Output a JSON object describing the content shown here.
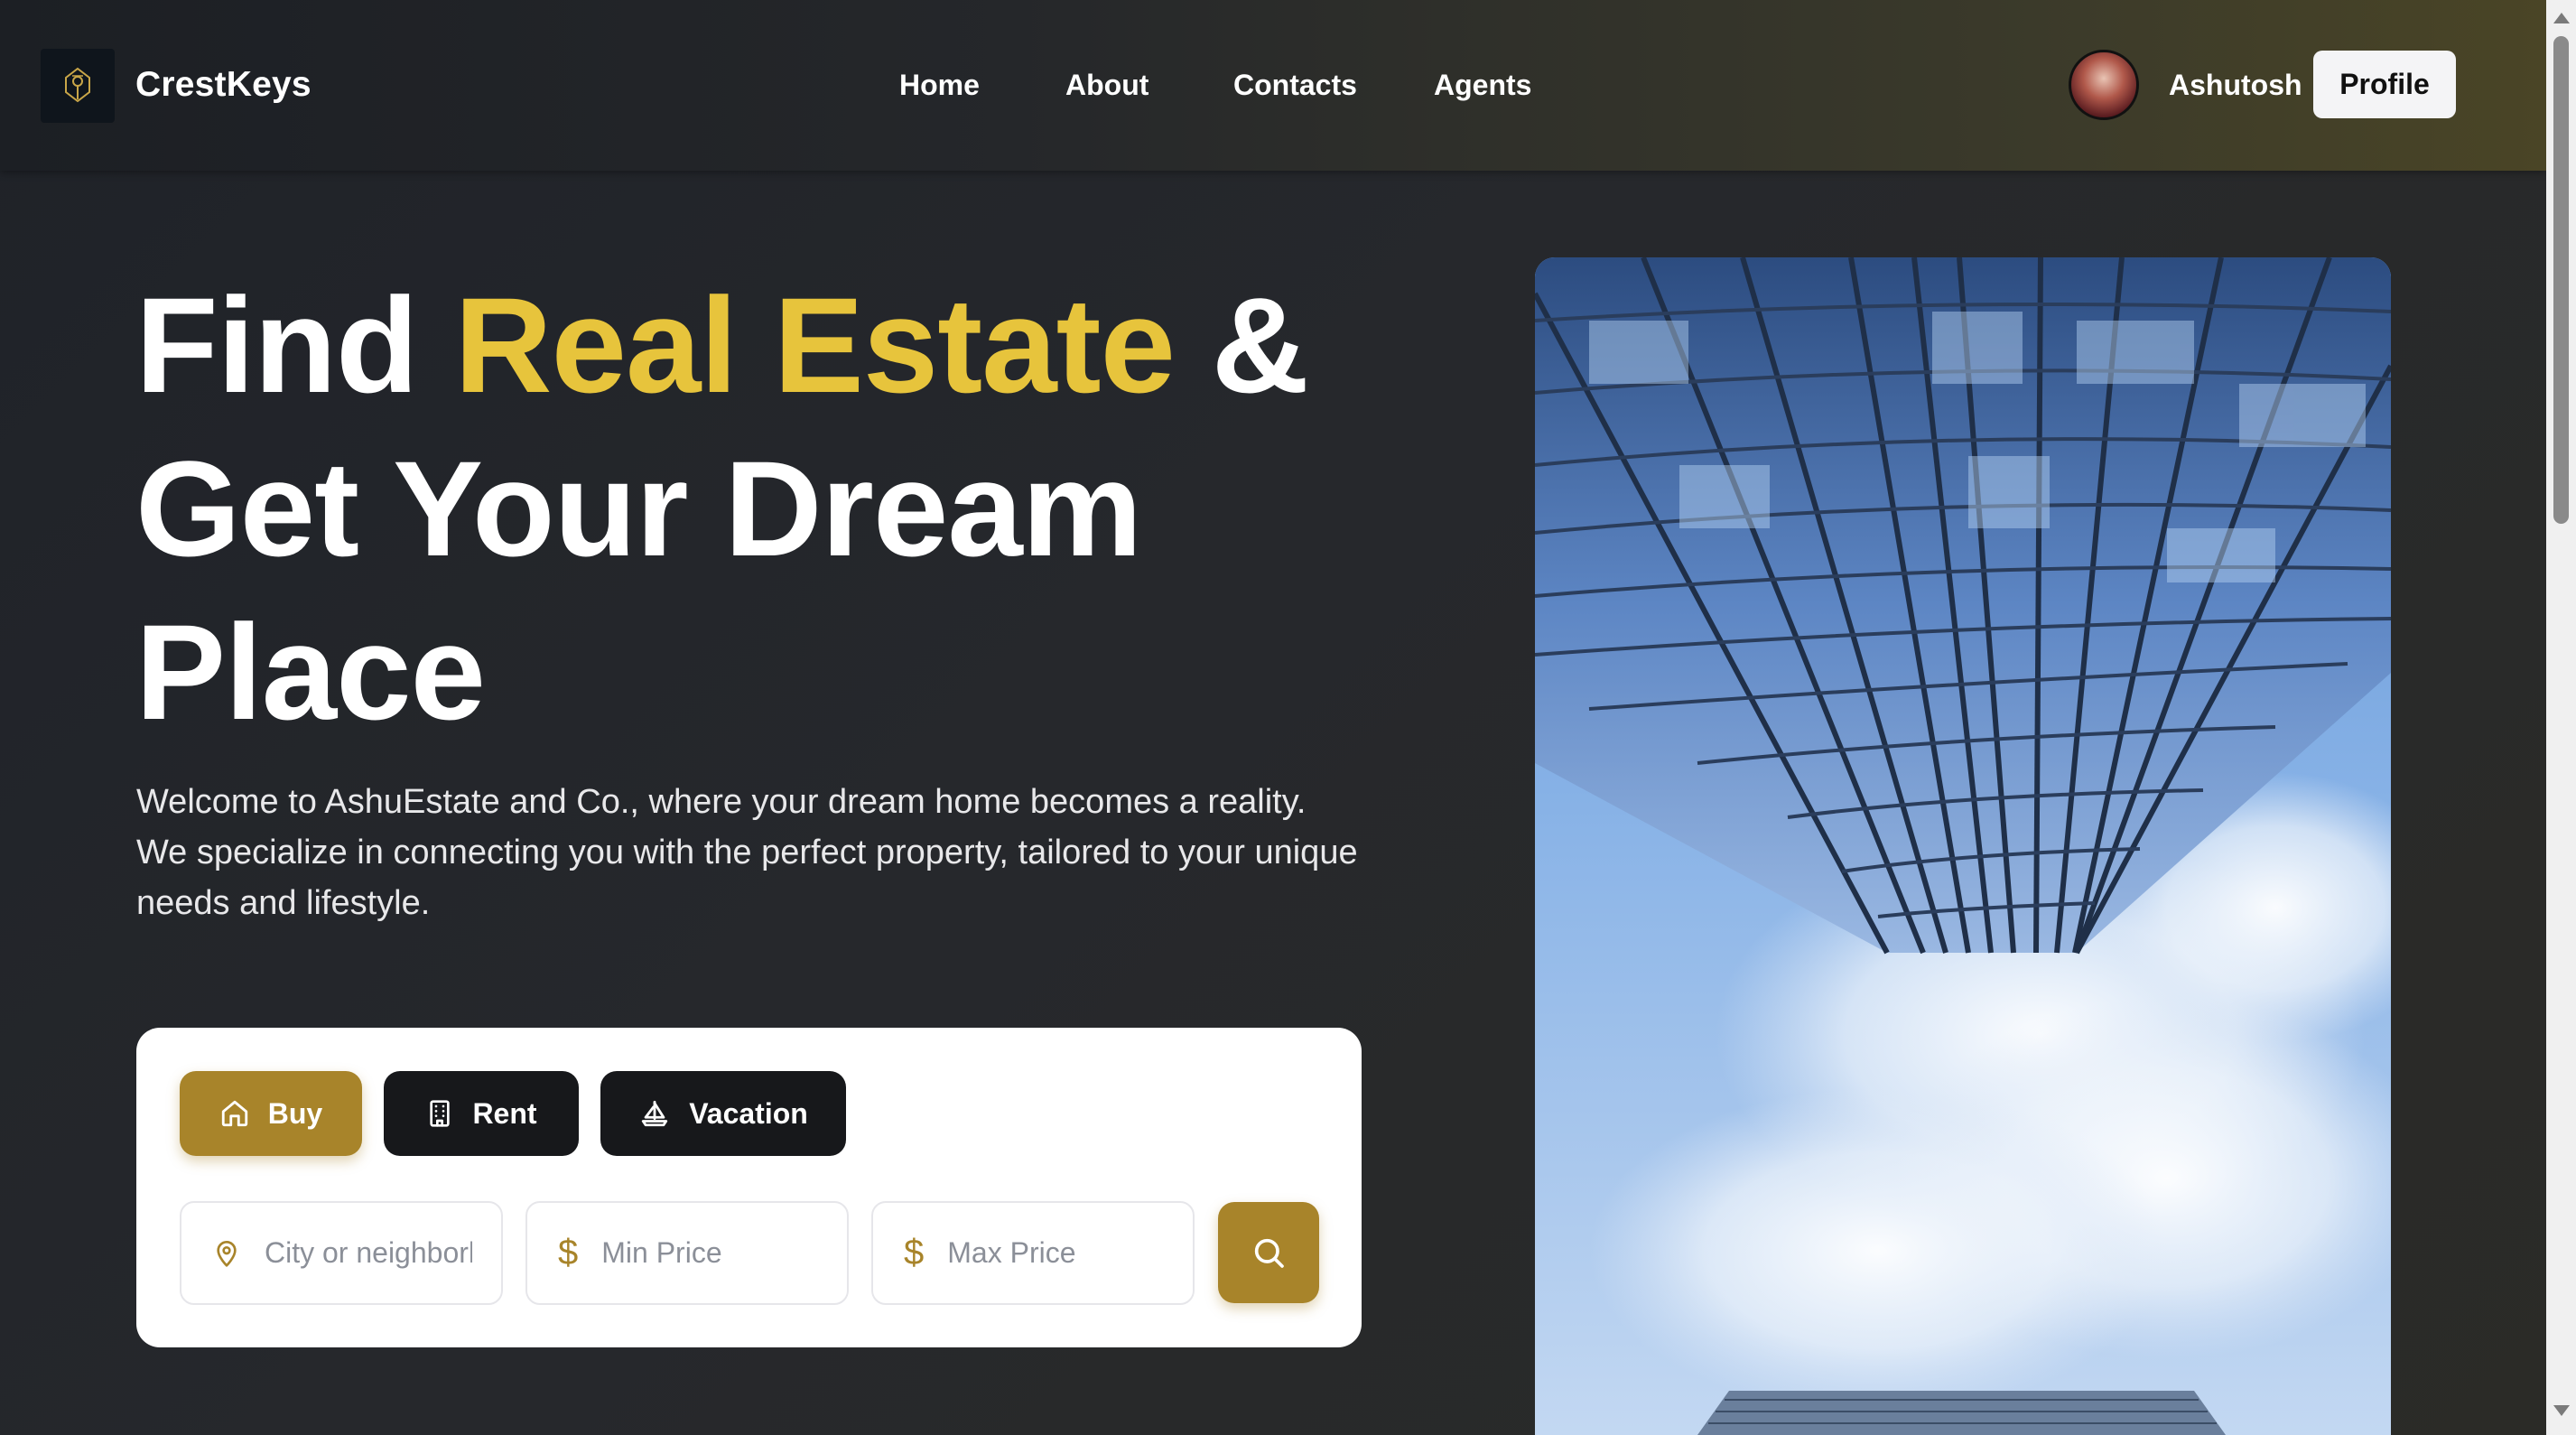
{
  "navbar": {
    "brand": "CrestKeys",
    "links": [
      "Home",
      "About",
      "Contacts",
      "Agents"
    ],
    "user_name": "Ashutosh",
    "profile_label": "Profile"
  },
  "hero": {
    "headline_part1": "Find ",
    "headline_accent": "Real Estate",
    "headline_part2": " & Get Your Dream Place",
    "intro": "Welcome to AshuEstate and Co., where your dream home becomes a reality. We specialize in connecting you with the perfect property, tailored to your unique needs and lifestyle."
  },
  "search": {
    "tabs": [
      {
        "label": "Buy",
        "icon": "home-icon",
        "active": true
      },
      {
        "label": "Rent",
        "icon": "building-icon",
        "active": false
      },
      {
        "label": "Vacation",
        "icon": "sailboat-icon",
        "active": false
      }
    ],
    "location_placeholder": "City or neighborhood",
    "min_price_placeholder": "Min Price",
    "max_price_placeholder": "Max Price",
    "currency_symbol": "$"
  },
  "colors": {
    "accent_gold": "#e7c43c",
    "button_gold": "#a8842a",
    "dark_button": "#17181b"
  }
}
